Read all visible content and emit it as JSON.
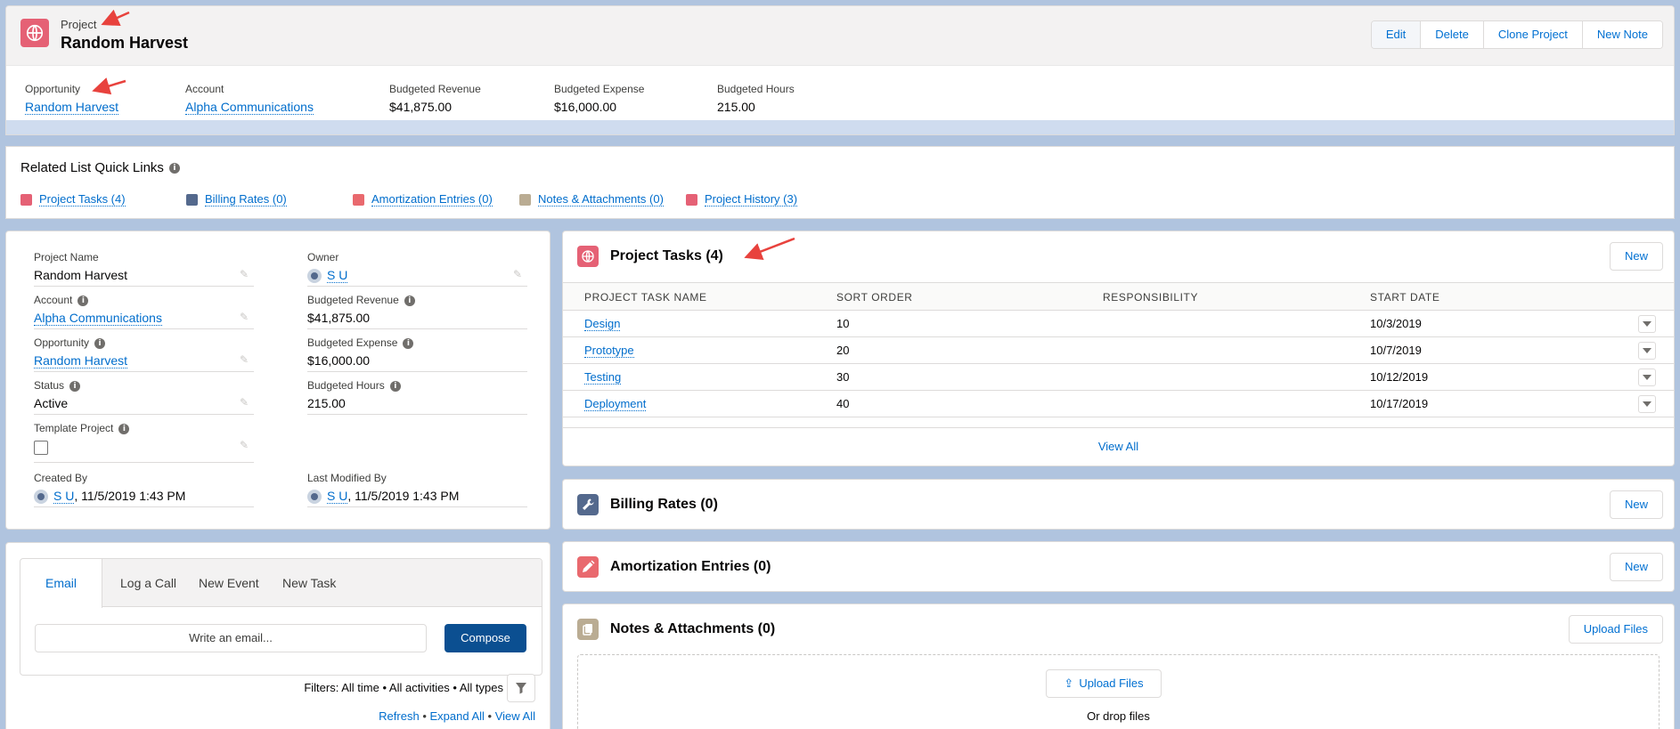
{
  "header": {
    "object_type": "Project",
    "title": "Random Harvest",
    "actions": [
      "Edit",
      "Delete",
      "Clone Project",
      "New Note"
    ],
    "highlights": [
      {
        "label": "Opportunity",
        "value": "Random Harvest",
        "is_link": true
      },
      {
        "label": "Account",
        "value": "Alpha Communications",
        "is_link": true
      },
      {
        "label": "Budgeted Revenue",
        "value": "$41,875.00",
        "is_link": false
      },
      {
        "label": "Budgeted Expense",
        "value": "$16,000.00",
        "is_link": false
      },
      {
        "label": "Budgeted Hours",
        "value": "215.00",
        "is_link": false
      }
    ]
  },
  "quick_links": {
    "title": "Related List Quick Links",
    "items": [
      {
        "label": "Project Tasks (4)",
        "icon": "globe-icon",
        "color": "#e56175"
      },
      {
        "label": "Billing Rates (0)",
        "icon": "wrench-icon",
        "color": "#54698d"
      },
      {
        "label": "Amortization Entries (0)",
        "icon": "pencil-icon",
        "color": "#e9696e"
      },
      {
        "label": "Notes & Attachments (0)",
        "icon": "notes-icon",
        "color": "#baac93"
      },
      {
        "label": "Project History (3)",
        "icon": "globe-icon",
        "color": "#e56175"
      }
    ]
  },
  "details": {
    "project_name": {
      "label": "Project Name",
      "value": "Random Harvest"
    },
    "owner": {
      "label": "Owner",
      "value": "S U"
    },
    "account": {
      "label": "Account",
      "value": "Alpha Communications"
    },
    "budgeted_revenue": {
      "label": "Budgeted Revenue",
      "value": "$41,875.00"
    },
    "opportunity": {
      "label": "Opportunity",
      "value": "Random Harvest"
    },
    "budgeted_expense": {
      "label": "Budgeted Expense",
      "value": "$16,000.00"
    },
    "status": {
      "label": "Status",
      "value": "Active"
    },
    "budgeted_hours": {
      "label": "Budgeted Hours",
      "value": "215.00"
    },
    "template_project": {
      "label": "Template Project",
      "checked": false
    },
    "created_by": {
      "label": "Created By",
      "user": "S U",
      "date": ", 11/5/2019 1:43 PM"
    },
    "last_modified_by": {
      "label": "Last Modified By",
      "user": "S U",
      "date": ", 11/5/2019 1:43 PM"
    }
  },
  "activity": {
    "tabs": [
      "Email",
      "Log a Call",
      "New Event",
      "New Task"
    ],
    "email_placeholder": "Write an email...",
    "compose_label": "Compose",
    "filters_text": "Filters: All time • All activities • All types",
    "links": {
      "refresh": "Refresh",
      "expand_all": "Expand All",
      "view_all": "View All",
      "sep": " • "
    }
  },
  "project_tasks": {
    "title": "Project Tasks (4)",
    "new_label": "New",
    "columns": [
      "PROJECT TASK NAME",
      "SORT ORDER",
      "RESPONSIBILITY",
      "START DATE"
    ],
    "rows": [
      {
        "name": "Design",
        "sort_order": "10",
        "responsibility": "",
        "start_date": "10/3/2019"
      },
      {
        "name": "Prototype",
        "sort_order": "20",
        "responsibility": "",
        "start_date": "10/7/2019"
      },
      {
        "name": "Testing",
        "sort_order": "30",
        "responsibility": "",
        "start_date": "10/12/2019"
      },
      {
        "name": "Deployment",
        "sort_order": "40",
        "responsibility": "",
        "start_date": "10/17/2019"
      }
    ],
    "view_all": "View All"
  },
  "billing_rates": {
    "title": "Billing Rates (0)",
    "new_label": "New"
  },
  "amortization": {
    "title": "Amortization Entries (0)",
    "new_label": "New"
  },
  "notes": {
    "title": "Notes & Attachments (0)",
    "upload_label": "Upload Files",
    "drop_upload_label": "Upload Files",
    "drop_text": "Or drop files"
  },
  "colors": {
    "accent": "#0070d2",
    "project_icon": "#e56175",
    "billing_icon": "#54698d",
    "amort_icon": "#e9696e",
    "notes_icon": "#baac93",
    "annotation_arrow": "#e8423d"
  }
}
